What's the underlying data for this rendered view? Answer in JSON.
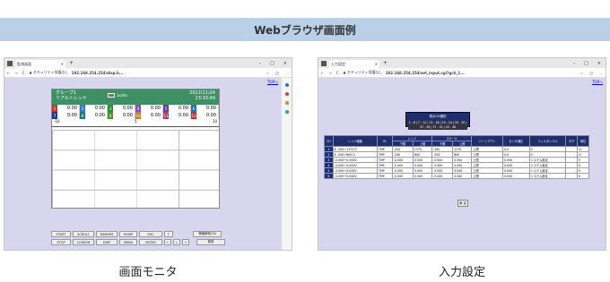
{
  "header": {
    "title": "Webブラウザ画面例"
  },
  "left": {
    "caption": "画面モニタ",
    "tab_title": "監視画面",
    "url_prefix": "▲ セキュリティ保護なし",
    "url": "192.168.254.254/disp.h...",
    "top_link": "TOPへ",
    "group_name": "グループ1",
    "mode": "リアルトレンド",
    "interval": "1s/div",
    "date": "2022/11/24",
    "time": "13:33:49",
    "channels_row1": [
      {
        "n": "1",
        "v": "0.00",
        "c": "#c0392b"
      },
      {
        "n": "2",
        "v": "0.00",
        "c": "#2d7bd1"
      },
      {
        "n": "3",
        "v": "0.00",
        "c": "#2c8c3a"
      },
      {
        "n": "4",
        "v": "0.00",
        "c": "#8a4fb8"
      },
      {
        "n": "5",
        "v": "0.00",
        "c": "#6b3fa0"
      },
      {
        "n": "6",
        "v": "0.00",
        "c": "#2c6fb7"
      }
    ],
    "channels_row2": [
      {
        "n": "7",
        "v": "0.00",
        "c": "#1c3f8c"
      },
      {
        "n": "8",
        "v": "0.00",
        "c": "#1f7a7a"
      },
      {
        "n": "9",
        "v": "0.00",
        "c": "#5a8f2a"
      },
      {
        "n": "10",
        "v": "0.00",
        "c": "#d07a20"
      },
      {
        "n": "11",
        "v": "0.00",
        "c": "#b04060"
      },
      {
        "n": "12",
        "v": "0.00",
        "c": "#c03030"
      }
    ],
    "scale_min": "-10",
    "scale_mid": "5",
    "scale_max": "10",
    "buttons_row1": [
      "START",
      "SCROLL",
      "MARKER",
      "HOME",
      "ESC",
      "↑",
      "警報解除ON"
    ],
    "buttons_row2": [
      "STOP",
      "CURSOR",
      "DISP",
      "MENU",
      "ENTER",
      "←",
      "↓",
      "→",
      "更新"
    ]
  },
  "right": {
    "caption": "入力設定",
    "tab_title": "入力設定",
    "url_prefix": "▲ セキュリティ保護なし",
    "url": "192.168.254.254/set_input.cgi?gch_1...",
    "top_link": "TOPへ",
    "selector_title": "表示CH選択",
    "selector_range": "1 - 6 | 7 - 12 | 13 - 18 | 19 - 24 | 25 - 30 | 31 - 36 | 37 - 42 | 43 - 48",
    "headers": {
      "ch": "CH",
      "range": "レンジ種類",
      "ri": "RI",
      "range_group": "レンジ",
      "scale_group": "スケール",
      "lower": "下限",
      "upper": "上限",
      "burnout": "バーンアウト",
      "sensor": "センサ補正",
      "filter": "フィルタレベル",
      "tag": "タグ",
      "unit": "単位"
    },
    "rows": [
      {
        "ch": "1",
        "range": "K -200〜1372℃",
        "ri": "TMP",
        "rl": "-200",
        "ru": "1370",
        "sl": "-200",
        "su": "1370",
        "bo": "上限",
        "sc": "0.0",
        "fl": "0",
        "tag": "",
        "unit": "℃"
      },
      {
        "ch": "2",
        "range": "E -200〜800℃",
        "ri": "TMP",
        "rl": "-200",
        "ru": "800",
        "sl": "-200",
        "su": "800",
        "bo": "上限",
        "sc": "0.0",
        "fl": "0",
        "tag": "",
        "unit": "℃"
      },
      {
        "ch": "3",
        "range": "-0.500〜0.500V",
        "ri": "TMP",
        "rl": "-0.500",
        "ru": "0.500",
        "sl": "-0.500",
        "su": "0.500",
        "bo": "上限",
        "sc": "0.000",
        "fl": "システム設定",
        "tag": "",
        "unit": "V"
      },
      {
        "ch": "4",
        "range": "-5.000〜5.000V",
        "ri": "TMP",
        "rl": "-5.000",
        "ru": "5.000",
        "sl": "-5.000",
        "su": "5.000",
        "bo": "上限",
        "sc": "0.000",
        "fl": "システム設定",
        "tag": "",
        "unit": "V"
      },
      {
        "ch": "5",
        "range": "-5.000〜5.000V",
        "ri": "TMP",
        "rl": "-5.000",
        "ru": "5.000",
        "sl": "-5.000",
        "su": "5.000",
        "bo": "上限",
        "sc": "0.000",
        "fl": "システム設定",
        "tag": "",
        "unit": "V"
      },
      {
        "ch": "6",
        "range": "-5.000〜5.000V",
        "ri": "TMP",
        "rl": "-5.000",
        "ru": "5.000",
        "sl": "-5.000",
        "su": "5.000",
        "bo": "上限",
        "sc": "0.000",
        "fl": "システム設定",
        "tag": "",
        "unit": "V"
      }
    ],
    "set_button": "設 定"
  },
  "colors": {
    "header_bg": "#b9d0e6",
    "content_bg": "#d8d6ee",
    "monitor_header": "#3f8f64",
    "table_header": "#1f2f6e"
  }
}
